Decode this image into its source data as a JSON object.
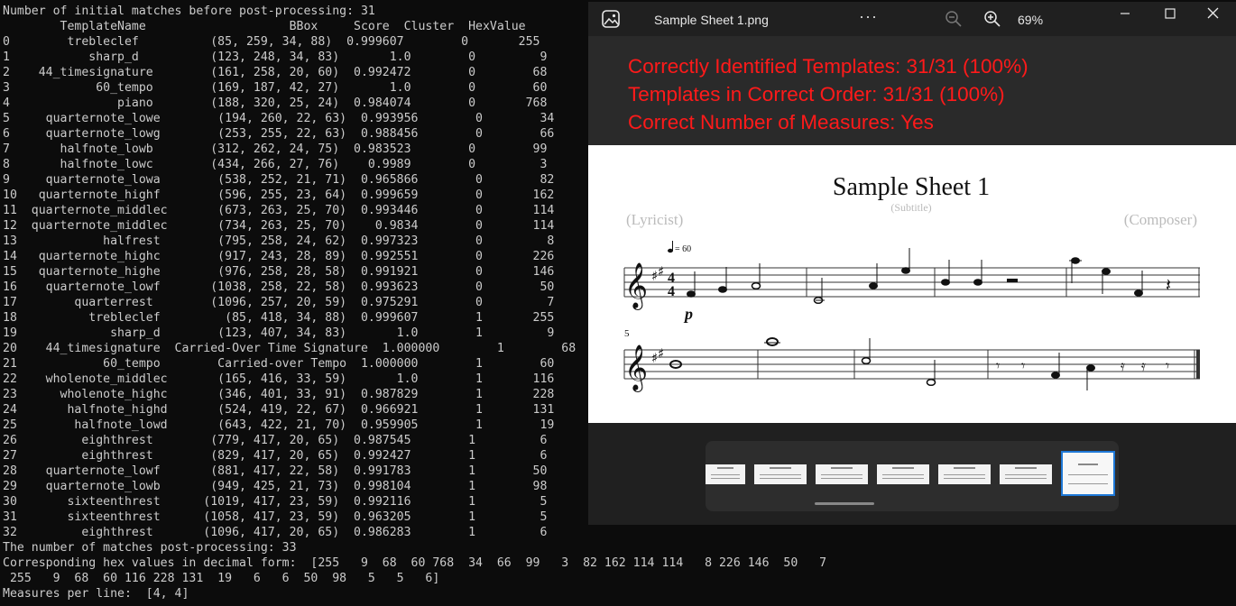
{
  "terminal": {
    "lines": [
      "Number of initial matches before post-processing: 31",
      "        TemplateName                    BBox     Score  Cluster  HexValue",
      "0        trebleclef          (85, 259, 34, 88)  0.999607        0       255",
      "1           sharp_d          (123, 248, 34, 83)       1.0        0         9",
      "2    44_timesignature        (161, 258, 20, 60)  0.992472        0        68",
      "3            60_tempo        (169, 187, 42, 27)       1.0        0        60",
      "4               piano        (188, 320, 25, 24)  0.984074        0       768",
      "5     quarternote_lowe        (194, 260, 22, 63)  0.993956        0        34",
      "6     quarternote_lowg        (253, 255, 22, 63)  0.988456        0        66",
      "7       halfnote_lowb        (312, 262, 24, 75)  0.983523        0        99",
      "8       halfnote_lowc        (434, 266, 27, 76)    0.9989        0         3",
      "9     quarternote_lowa        (538, 252, 21, 71)  0.965866        0        82",
      "10   quarternote_highf        (596, 255, 23, 64)  0.999659        0       162",
      "11  quarternote_middlec       (673, 263, 25, 70)  0.993446        0       114",
      "12  quarternote_middlec       (734, 263, 25, 70)    0.9834        0       114",
      "13            halfrest        (795, 258, 24, 62)  0.997323        0         8",
      "14   quarternote_highc        (917, 243, 28, 89)  0.992551        0       226",
      "15   quarternote_highe        (976, 258, 28, 58)  0.991921        0       146",
      "16    quarternote_lowf       (1038, 258, 22, 58)  0.993623        0        50",
      "17        quarterrest        (1096, 257, 20, 59)  0.975291        0         7",
      "18          trebleclef         (85, 418, 34, 88)  0.999607        1       255",
      "19             sharp_d        (123, 407, 34, 83)       1.0        1         9",
      "20    44_timesignature  Carried-Over Time Signature  1.000000        1        68",
      "21            60_tempo        Carried-over Tempo  1.000000        1        60",
      "22    wholenote_middlec       (165, 416, 33, 59)       1.0        1       116",
      "23      wholenote_highc       (346, 401, 33, 91)  0.987829        1       228",
      "24       halfnote_highd       (524, 419, 22, 67)  0.966921        1       131",
      "25        halfnote_lowd       (643, 422, 21, 70)  0.959905        1        19",
      "26         eighthrest        (779, 417, 20, 65)  0.987545        1         6",
      "27         eighthrest        (829, 417, 20, 65)  0.992427        1         6",
      "28    quarternote_lowf       (881, 417, 22, 58)  0.991783        1        50",
      "29    quarternote_lowb       (949, 425, 21, 73)  0.998104        1        98",
      "30       sixteenthrest      (1019, 417, 23, 59)  0.992116        1         5",
      "31       sixteenthrest      (1058, 417, 23, 59)  0.963205        1         5",
      "32         eighthrest       (1096, 417, 20, 65)  0.986283        1         6",
      "The number of matches post-processing: 33",
      "Corresponding hex values in decimal form:  [255   9  68  60 768  34  66  99   3  82 162 114 114   8 226 146  50   7",
      " 255   9  68  60 116 228 131  19   6   6  50  98   5   5   6]",
      "Measures per line:  [4, 4]"
    ]
  },
  "viewer": {
    "file_title": "Sample Sheet 1.png",
    "more_label": "···",
    "zoom_level": "69%",
    "summary": [
      "Correctly Identified Templates: 31/31 (100%)",
      "Templates in Correct Order: 31/31 (100%)",
      "Correct Number of Measures: Yes"
    ],
    "sheet": {
      "title": "Sample Sheet 1",
      "subtitle": "(Subtitle)",
      "lyricist": "(Lyricist)",
      "composer": "(Composer)",
      "tempo": "= 60",
      "dynamic": "p",
      "measure_number": "5"
    },
    "thumbnail_count": 7,
    "selected_thumbnail_index": 6
  },
  "colors": {
    "terminal_bg": "#0c0c0c",
    "terminal_text": "#cccccc",
    "summary_text": "#ff1a1a",
    "viewer_bg": "#202020",
    "selection_accent": "#1e78d7"
  }
}
